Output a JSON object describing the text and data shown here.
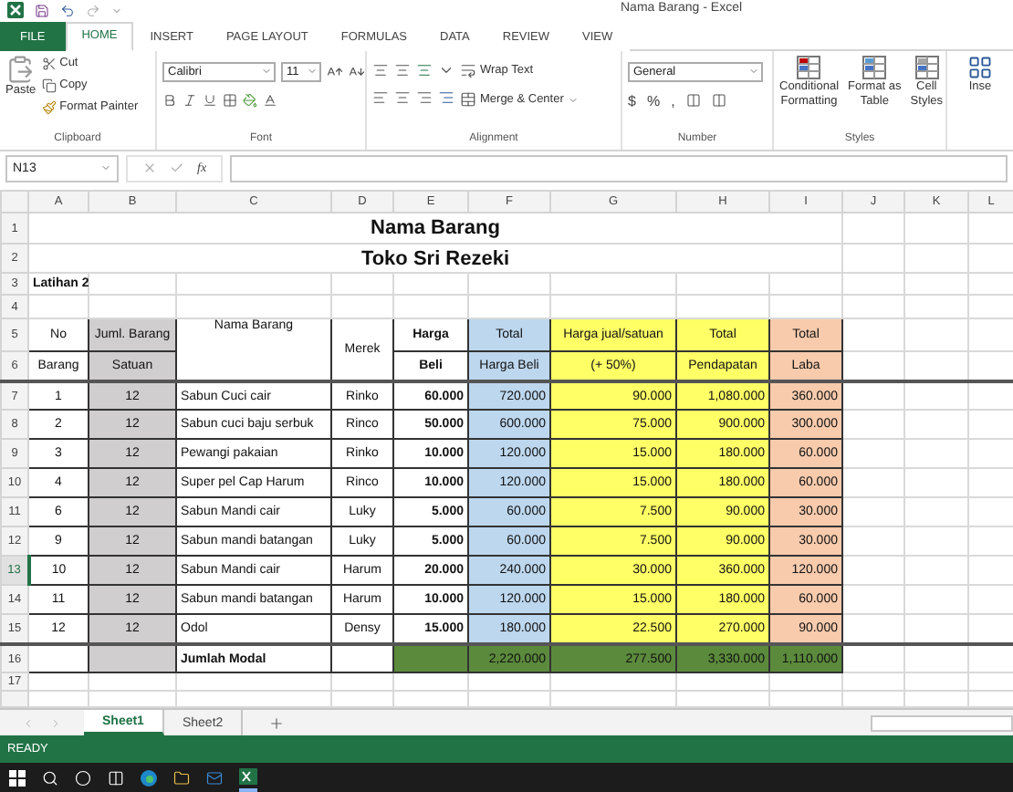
{
  "window": {
    "title": "Nama Barang - Excel"
  },
  "ribbon_tabs": [
    {
      "label": "FILE",
      "kind": "file",
      "selected": false
    },
    {
      "label": "HOME",
      "kind": "tab",
      "selected": true
    },
    {
      "label": "INSERT",
      "kind": "tab",
      "selected": false
    },
    {
      "label": "PAGE LAYOUT",
      "kind": "tab",
      "selected": false
    },
    {
      "label": "FORMULAS",
      "kind": "tab",
      "selected": false
    },
    {
      "label": "DATA",
      "kind": "tab",
      "selected": false
    },
    {
      "label": "REVIEW",
      "kind": "tab",
      "selected": false
    },
    {
      "label": "VIEW",
      "kind": "tab",
      "selected": false
    }
  ],
  "clipboard": {
    "paste": "Paste",
    "cut": "Cut",
    "copy": "Copy",
    "format_painter": "Format Painter",
    "label": "Clipboard"
  },
  "font": {
    "name": "Calibri",
    "size": "11",
    "label": "Font"
  },
  "alignment": {
    "wrap_text": "Wrap Text",
    "merge_center": "Merge & Center",
    "label": "Alignment"
  },
  "number": {
    "format": "General",
    "symbols": [
      "$",
      "%",
      ","
    ],
    "label": "Number"
  },
  "styles": {
    "buttons": [
      [
        "Conditional",
        "Formatting"
      ],
      [
        "Format as",
        "Table"
      ],
      [
        "Cell",
        "Styles"
      ]
    ],
    "label": "Styles"
  },
  "cells": {
    "insert": "Inse"
  },
  "formula_bar": {
    "name_box": "N13",
    "fx": "fx"
  },
  "sheet": {
    "columns": [
      "A",
      "B",
      "C",
      "D",
      "E",
      "F",
      "G",
      "H",
      "I",
      "J",
      "K",
      "L"
    ],
    "rows": [
      {
        "label": "1",
        "selected": false
      },
      {
        "label": "2",
        "selected": false
      },
      {
        "label": "3",
        "selected": false
      },
      {
        "label": "4",
        "selected": false
      },
      {
        "label": "5",
        "selected": false
      },
      {
        "label": "6",
        "selected": false
      },
      {
        "label": "7",
        "selected": false
      },
      {
        "label": "8",
        "selected": false
      },
      {
        "label": "9",
        "selected": false
      },
      {
        "label": "10",
        "selected": false
      },
      {
        "label": "11",
        "selected": false
      },
      {
        "label": "12",
        "selected": false
      },
      {
        "label": "13",
        "selected": true
      },
      {
        "label": "14",
        "selected": false
      },
      {
        "label": "15",
        "selected": false
      },
      {
        "label": "16",
        "selected": false
      },
      {
        "label": "17",
        "selected": false
      }
    ],
    "title_lines": [
      "Nama Barang",
      "Toko Sri Rezeki"
    ],
    "subtitle": "Latihan 2",
    "header_top": [
      "No",
      "Juml. Barang",
      "Nama Barang",
      "Merek",
      "Harga",
      "Total",
      "Harga jual/satuan",
      "Total",
      "Total"
    ],
    "header_bottom": [
      "Barang",
      "Satuan",
      "Beli",
      "Harga Beli",
      "(+ 50%)",
      "Pendapatan",
      "Laba"
    ],
    "data_rows": [
      [
        "1",
        "12",
        "Sabun Cuci cair",
        "Rinko",
        "60.000",
        "720.000",
        "90.000",
        "1,080.000",
        "360.000"
      ],
      [
        "2",
        "12",
        "Sabun cuci baju serbuk",
        "Rinco",
        "50.000",
        "600.000",
        "75.000",
        "900.000",
        "300.000"
      ],
      [
        "3",
        "12",
        "Pewangi pakaian",
        "Rinko",
        "10.000",
        "120.000",
        "15.000",
        "180.000",
        "60.000"
      ],
      [
        "4",
        "12",
        "Super pel Cap Harum",
        "Rinco",
        "10.000",
        "120.000",
        "15.000",
        "180.000",
        "60.000"
      ],
      [
        "6",
        "12",
        "Sabun Mandi cair",
        "Luky",
        "5.000",
        "60.000",
        "7.500",
        "90.000",
        "30.000"
      ],
      [
        "9",
        "12",
        "Sabun mandi batangan",
        "Luky",
        "5.000",
        "60.000",
        "7.500",
        "90.000",
        "30.000"
      ],
      [
        "10",
        "12",
        "Sabun Mandi cair",
        "Harum",
        "20.000",
        "240.000",
        "30.000",
        "360.000",
        "120.000"
      ],
      [
        "11",
        "12",
        "Sabun mandi batangan",
        "Harum",
        "10.000",
        "120.000",
        "15.000",
        "180.000",
        "60.000"
      ],
      [
        "12",
        "12",
        "Odol",
        "Densy",
        "15.000",
        "180.000",
        "22.500",
        "270.000",
        "90.000"
      ]
    ],
    "total_row": {
      "label": "Jumlah Modal",
      "values": [
        "2,220.000",
        "277.500",
        "3,330.000",
        "1,110.000"
      ]
    }
  },
  "sheet_tabs": [
    {
      "label": "Sheet1",
      "selected": true
    },
    {
      "label": "Sheet2",
      "selected": false
    }
  ],
  "status_bar": {
    "text": "READY"
  }
}
